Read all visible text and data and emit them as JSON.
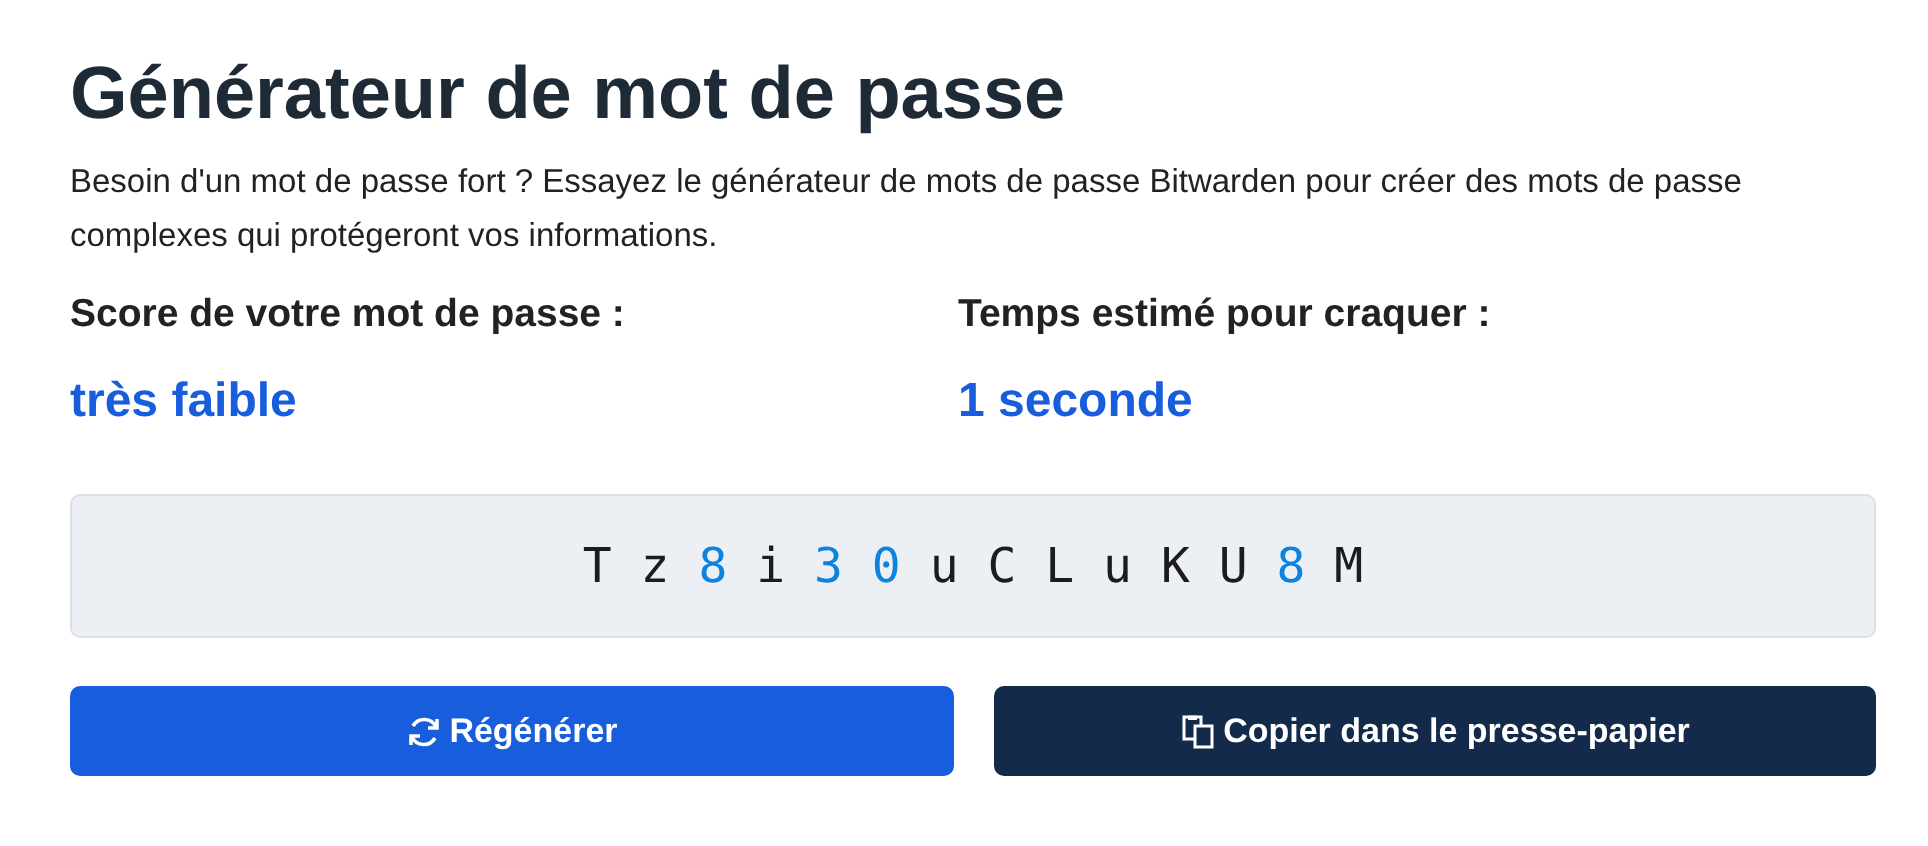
{
  "title": "Générateur de mot de passe",
  "description": "Besoin d'un mot de passe fort ? Essayez le générateur de mots de passe Bitwarden pour créer des mots de passe complexes qui protégeront vos informations.",
  "stats": [
    {
      "label": "Score de votre mot de passe :",
      "value": "très faible"
    },
    {
      "label": "Temps estimé pour craquer :",
      "value": "1 seconde"
    }
  ],
  "password": [
    {
      "char": "T",
      "kind": "letter"
    },
    {
      "char": "z",
      "kind": "letter"
    },
    {
      "char": "8",
      "kind": "digit"
    },
    {
      "char": "i",
      "kind": "letter"
    },
    {
      "char": "3",
      "kind": "digit"
    },
    {
      "char": "0",
      "kind": "digit"
    },
    {
      "char": "u",
      "kind": "letter"
    },
    {
      "char": "C",
      "kind": "letter"
    },
    {
      "char": "L",
      "kind": "letter"
    },
    {
      "char": "u",
      "kind": "letter"
    },
    {
      "char": "K",
      "kind": "letter"
    },
    {
      "char": "U",
      "kind": "letter"
    },
    {
      "char": "8",
      "kind": "digit"
    },
    {
      "char": "M",
      "kind": "letter"
    }
  ],
  "buttons": [
    {
      "label": "Régénérer",
      "kind": "regenerate"
    },
    {
      "label": "Copier dans le presse-papier",
      "kind": "copy"
    }
  ]
}
